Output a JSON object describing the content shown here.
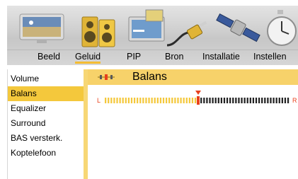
{
  "tabs": [
    {
      "label": "Beeld",
      "icon": "monitor-icon"
    },
    {
      "label": "Geluid",
      "icon": "speakers-icon",
      "active": true
    },
    {
      "label": "PIP",
      "icon": "picture-in-picture-icon"
    },
    {
      "label": "Bron",
      "icon": "plug-cable-icon"
    },
    {
      "label": "Installatie",
      "icon": "satellite-icon"
    },
    {
      "label": "Instellen",
      "icon": "stopwatch-icon"
    }
  ],
  "menu": {
    "items": [
      "Volume",
      "Balans",
      "Equalizer",
      "Surround",
      "BAS versterk.",
      "Koptelefoon"
    ],
    "selected": "Balans"
  },
  "header": {
    "title": "Balans",
    "icon": "balance-icon"
  },
  "balance": {
    "left_label": "L",
    "right_label": "R",
    "position": 0.5,
    "colors": {
      "left": "#f4c83c",
      "right": "#222222",
      "marker": "#e8401c"
    }
  },
  "colors": {
    "accent": "#f4c83c",
    "header": "#f7d26a",
    "strip": "#f7d775"
  }
}
